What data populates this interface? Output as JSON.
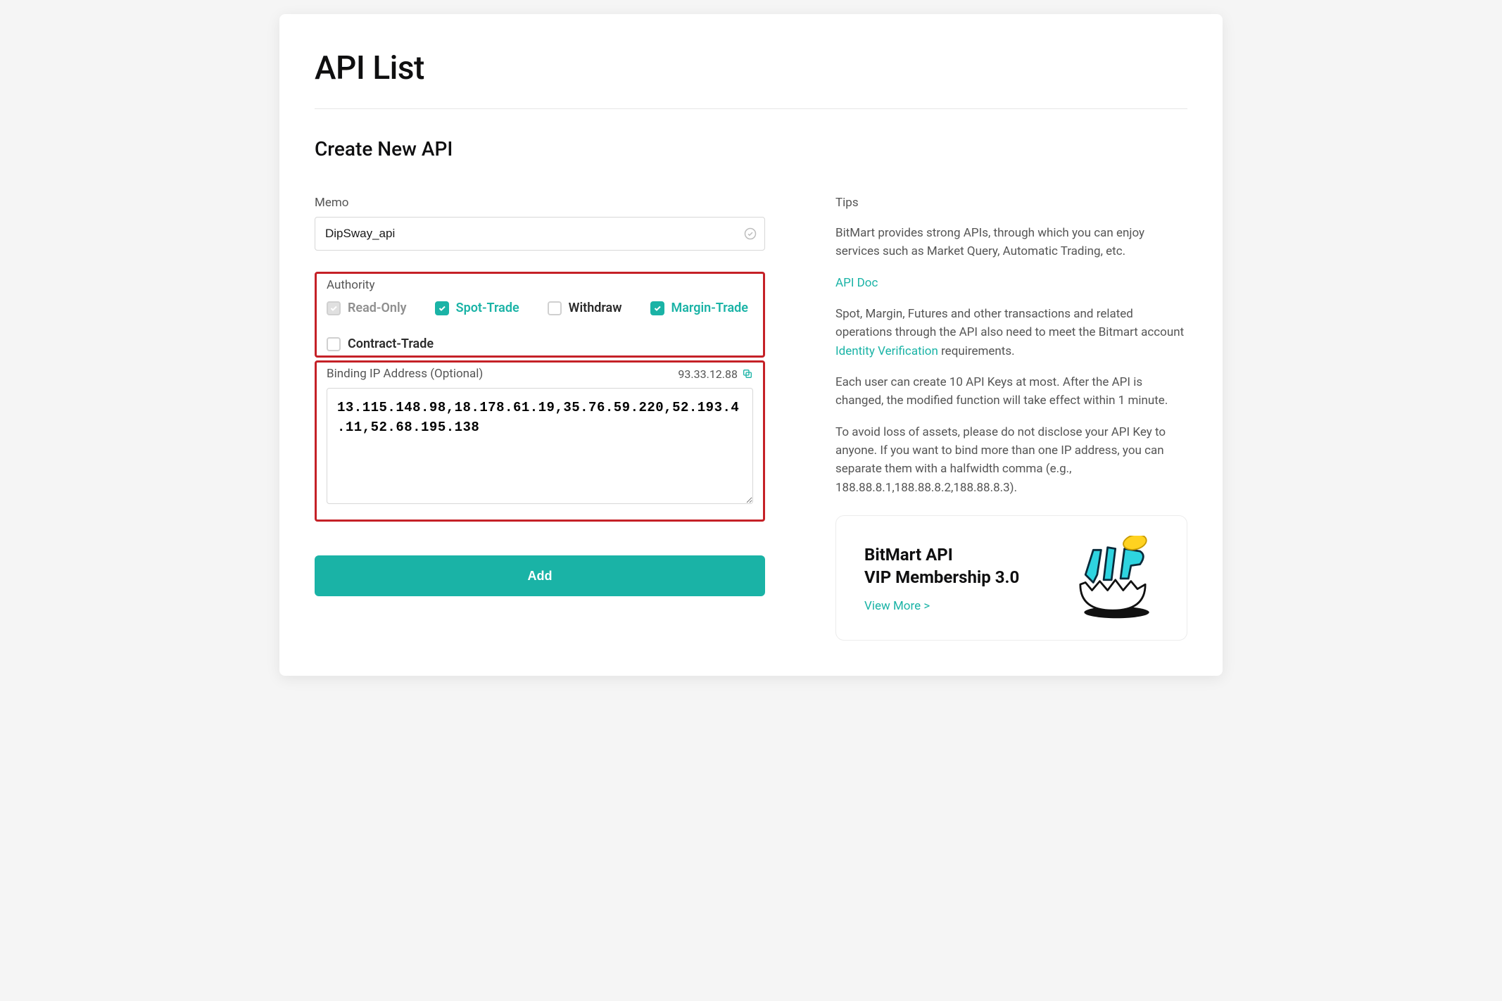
{
  "page_title": "API List",
  "section_title": "Create New API",
  "memo": {
    "label": "Memo",
    "value": "DipSway_api"
  },
  "authority": {
    "label": "Authority",
    "options": [
      {
        "key": "read_only",
        "label": "Read-Only",
        "checked": true,
        "disabled": true
      },
      {
        "key": "spot_trade",
        "label": "Spot-Trade",
        "checked": true,
        "disabled": false
      },
      {
        "key": "withdraw",
        "label": "Withdraw",
        "checked": false,
        "disabled": false
      },
      {
        "key": "margin_trade",
        "label": "Margin-Trade",
        "checked": true,
        "disabled": false
      },
      {
        "key": "contract_trade",
        "label": "Contract-Trade",
        "checked": false,
        "disabled": false
      }
    ]
  },
  "binding": {
    "label": "Binding IP Address (Optional)",
    "current_ip": "93.33.12.88",
    "value": "13.115.148.98,18.178.61.19,35.76.59.220,52.193.4.11,52.68.195.138"
  },
  "add_button": "Add",
  "tips": {
    "heading": "Tips",
    "p1": "BitMart provides strong APIs, through which you can enjoy services such as Market Query, Automatic Trading, etc.",
    "api_doc": "API Doc",
    "p2a": "Spot, Margin, Futures and other transactions and related operations through the API also need to meet the Bitmart account ",
    "identity_link": "Identity Verification",
    "p2b": " requirements.",
    "p3": "Each user can create 10 API Keys at most. After the API is changed, the modified function will take effect within 1 minute.",
    "p4": "To avoid loss of assets, please do not disclose your API Key to anyone. If you want to bind more than one IP address, you can separate them with a halfwidth comma (e.g., 188.88.8.1,188.88.8.2,188.88.8.3)."
  },
  "promo": {
    "line1": "BitMart API",
    "line2": "VIP Membership 3.0",
    "link": "View More >"
  }
}
